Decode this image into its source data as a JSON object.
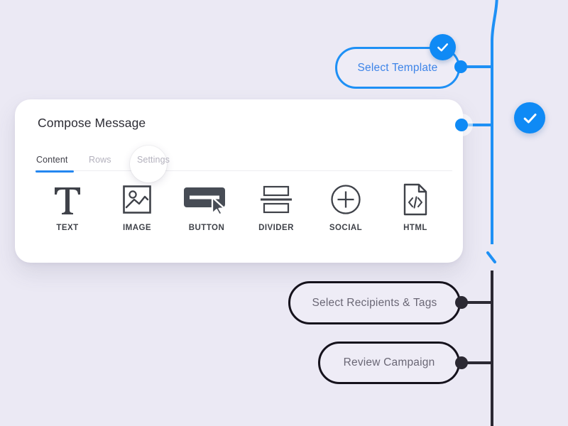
{
  "theme": {
    "background": "#ebe9f4",
    "accent_blue": "#0f8af5",
    "line_dark": "#2b2933",
    "card_bg": "#ffffff",
    "tab_active_underline": "#2487f0"
  },
  "flow": {
    "steps": [
      {
        "id": "select-template",
        "label": "Select Template",
        "state": "completed",
        "style": "blue-outline"
      },
      {
        "id": "compose-message",
        "label": "Compose Message",
        "state": "completed",
        "style": "card"
      },
      {
        "id": "select-recipients",
        "label": "Select Recipients & Tags",
        "state": "pending",
        "style": "dark-outline"
      },
      {
        "id": "review-campaign",
        "label": "Review Campaign",
        "state": "pending",
        "style": "dark-outline"
      }
    ],
    "check_badges": [
      {
        "for": "select-template",
        "icon": "check-icon"
      },
      {
        "for": "compose-message",
        "icon": "check-icon"
      }
    ]
  },
  "compose_card": {
    "title": "Compose Message",
    "tabs": [
      {
        "id": "content",
        "label": "Content",
        "active": true
      },
      {
        "id": "rows",
        "label": "Rows",
        "active": false
      },
      {
        "id": "settings",
        "label": "Settings",
        "active": false,
        "highlighted": true
      }
    ],
    "blocks": [
      {
        "id": "text",
        "label": "TEXT",
        "icon": "text-t-icon"
      },
      {
        "id": "image",
        "label": "IMAGE",
        "icon": "image-icon"
      },
      {
        "id": "button",
        "label": "BUTTON",
        "icon": "button-icon"
      },
      {
        "id": "divider",
        "label": "DIVIDER",
        "icon": "divider-icon"
      },
      {
        "id": "social",
        "label": "SOCIAL",
        "icon": "plus-circle-icon"
      },
      {
        "id": "html",
        "label": "HTML",
        "icon": "code-file-icon"
      }
    ]
  }
}
